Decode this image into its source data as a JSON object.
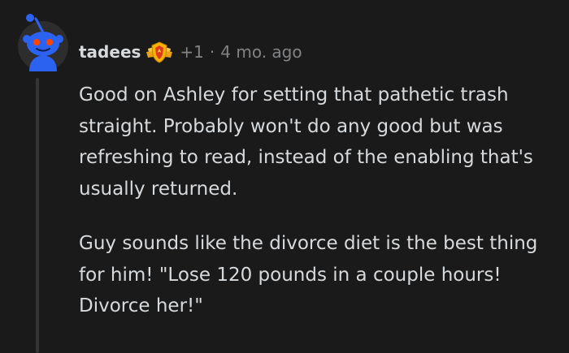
{
  "comment": {
    "author": "tadees",
    "score": "+1",
    "separator": "·",
    "time_ago": "4 mo. ago",
    "avatar_icon": "snoo-avatar-icon",
    "flair_icon": "award-badge-icon",
    "paragraphs": [
      "Good on Ashley for setting that pathetic trash straight. Probably won't do any good but was refreshing to read, instead of the enabling that's usually returned.",
      "Guy sounds like the divorce diet is the best thing for him! \"Lose 120 pounds in a couple hours! Divorce her!\""
    ]
  },
  "colors": {
    "background": "#1a1a1b",
    "text": "#d7dadc",
    "meta_text": "#818384",
    "thread_line": "#343536",
    "avatar_blue": "#2b63f0",
    "avatar_eyes": "#ff4500"
  }
}
